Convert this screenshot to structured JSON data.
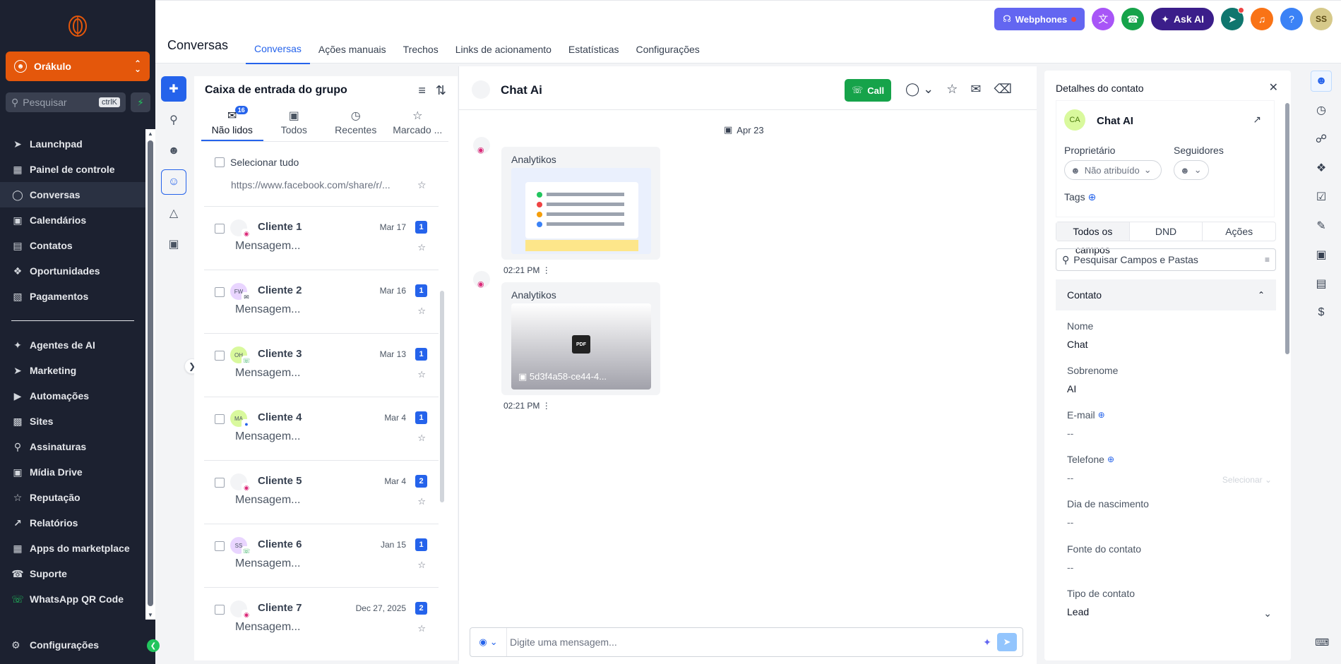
{
  "sidebar": {
    "account": "Orákulo",
    "search_placeholder": "Pesquisar",
    "search_kbd": "ctrlK",
    "items": [
      {
        "label": "Launchpad",
        "icon": "rocket-icon"
      },
      {
        "label": "Painel de controle",
        "icon": "dashboard-icon"
      },
      {
        "label": "Conversas",
        "icon": "chat-icon"
      },
      {
        "label": "Calendários",
        "icon": "calendar-icon"
      },
      {
        "label": "Contatos",
        "icon": "contacts-icon"
      },
      {
        "label": "Oportunidades",
        "icon": "opportunities-icon"
      },
      {
        "label": "Pagamentos",
        "icon": "payments-icon"
      }
    ],
    "items2": [
      {
        "label": "Agentes de AI",
        "icon": "sparkle-icon"
      },
      {
        "label": "Marketing",
        "icon": "send-icon"
      },
      {
        "label": "Automações",
        "icon": "automation-icon"
      },
      {
        "label": "Sites",
        "icon": "sites-icon"
      },
      {
        "label": "Assinaturas",
        "icon": "badge-icon"
      },
      {
        "label": "Mídia Drive",
        "icon": "image-icon"
      },
      {
        "label": "Reputação",
        "icon": "star-icon"
      },
      {
        "label": "Relatórios",
        "icon": "chart-icon"
      },
      {
        "label": "Apps do marketplace",
        "icon": "apps-icon"
      },
      {
        "label": "Suporte",
        "icon": "support-icon"
      },
      {
        "label": "WhatsApp QR Code",
        "icon": "whatsapp-icon"
      }
    ],
    "settings": "Configurações"
  },
  "header": {
    "page_title": "Conversas",
    "tabs": [
      "Conversas",
      "Ações manuais",
      "Trechos",
      "Links de acionamento",
      "Estatísticas",
      "Configurações"
    ],
    "webphones": "Webphones",
    "ask_ai": "Ask AI",
    "user_initials": "SS"
  },
  "inbox": {
    "title": "Caixa de entrada do grupo",
    "tabs": [
      {
        "label": "Não lidos",
        "count": "16"
      },
      {
        "label": "Todos"
      },
      {
        "label": "Recentes"
      },
      {
        "label": "Marcado ..."
      }
    ],
    "select_all": "Selecionar tudo",
    "preview_link": "https://www.facebook.com/share/r/...",
    "rows": [
      {
        "name": "Cliente 1",
        "date": "Mar 17",
        "unread": "1",
        "msg": "Mensagem...",
        "avatar": "",
        "channel": "instagram"
      },
      {
        "name": "Cliente 2",
        "date": "Mar 16",
        "unread": "1",
        "msg": "Mensagem...",
        "avatar": "FW",
        "channel": "email"
      },
      {
        "name": "Cliente 3",
        "date": "Mar 13",
        "unread": "1",
        "msg": "Mensagem...",
        "avatar": "OH",
        "channel": "whatsapp"
      },
      {
        "name": "Cliente 4",
        "date": "Mar 4",
        "unread": "1",
        "msg": "Mensagem...",
        "avatar": "MA",
        "channel": "messenger"
      },
      {
        "name": "Cliente 5",
        "date": "Mar 4",
        "unread": "2",
        "msg": "Mensagem...",
        "avatar": "",
        "channel": "instagram"
      },
      {
        "name": "Cliente 6",
        "date": "Jan 15",
        "unread": "1",
        "msg": "Mensagem...",
        "avatar": "SS",
        "channel": "whatsapp"
      },
      {
        "name": "Cliente 7",
        "date": "Dec 27, 2025",
        "unread": "2",
        "msg": "Mensagem...",
        "avatar": "",
        "channel": "instagram"
      }
    ]
  },
  "chat": {
    "title": "Chat Ai",
    "call": "Call",
    "date_chip": "Apr 23",
    "messages": [
      {
        "sender": "Analytikos",
        "time": "02:21 PM",
        "type": "image"
      },
      {
        "sender": "Analytikos",
        "time": "02:21 PM",
        "type": "pdf",
        "filename": "5d3f4a58-ce44-4..."
      }
    ],
    "composer_placeholder": "Digite uma mensagem..."
  },
  "details": {
    "title": "Detalhes do contato",
    "initials": "CA",
    "name": "Chat AI",
    "owner_label": "Proprietário",
    "owner_value": "Não atribuído",
    "followers_label": "Seguidores",
    "tags_label": "Tags",
    "tabs": [
      "Todos os campos",
      "DND",
      "Ações"
    ],
    "search_placeholder": "Pesquisar Campos e Pastas",
    "section": "Contato",
    "fields": [
      {
        "label": "Nome",
        "value": "Chat"
      },
      {
        "label": "Sobrenome",
        "value": "AI"
      },
      {
        "label": "E-mail",
        "value": "--"
      },
      {
        "label": "Telefone",
        "value": "--",
        "right": "Selecionar"
      },
      {
        "label": "Dia de nascimento",
        "value": "--"
      },
      {
        "label": "Fonte do contato",
        "value": "--"
      },
      {
        "label": "Tipo de contato",
        "value": "Lead"
      }
    ]
  },
  "colors": {
    "accent": "#2563eb",
    "account": "#e4570b",
    "sidebar_bg": "#1c2130",
    "call_green": "#16a34a",
    "webphones": "#6366f1"
  }
}
